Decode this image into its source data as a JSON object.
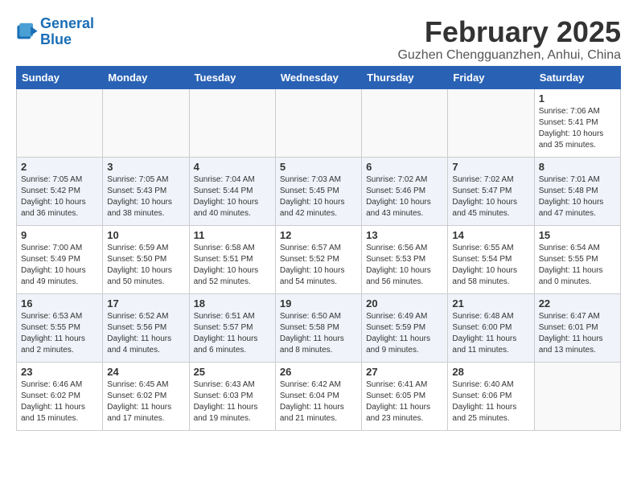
{
  "logo": {
    "general": "General",
    "blue": "Blue"
  },
  "title": "February 2025",
  "subtitle": "Guzhen Chengguanzhen, Anhui, China",
  "days_of_week": [
    "Sunday",
    "Monday",
    "Tuesday",
    "Wednesday",
    "Thursday",
    "Friday",
    "Saturday"
  ],
  "weeks": [
    [
      {
        "day": "",
        "info": ""
      },
      {
        "day": "",
        "info": ""
      },
      {
        "day": "",
        "info": ""
      },
      {
        "day": "",
        "info": ""
      },
      {
        "day": "",
        "info": ""
      },
      {
        "day": "",
        "info": ""
      },
      {
        "day": "1",
        "info": "Sunrise: 7:06 AM\nSunset: 5:41 PM\nDaylight: 10 hours\nand 35 minutes."
      }
    ],
    [
      {
        "day": "2",
        "info": "Sunrise: 7:05 AM\nSunset: 5:42 PM\nDaylight: 10 hours\nand 36 minutes."
      },
      {
        "day": "3",
        "info": "Sunrise: 7:05 AM\nSunset: 5:43 PM\nDaylight: 10 hours\nand 38 minutes."
      },
      {
        "day": "4",
        "info": "Sunrise: 7:04 AM\nSunset: 5:44 PM\nDaylight: 10 hours\nand 40 minutes."
      },
      {
        "day": "5",
        "info": "Sunrise: 7:03 AM\nSunset: 5:45 PM\nDaylight: 10 hours\nand 42 minutes."
      },
      {
        "day": "6",
        "info": "Sunrise: 7:02 AM\nSunset: 5:46 PM\nDaylight: 10 hours\nand 43 minutes."
      },
      {
        "day": "7",
        "info": "Sunrise: 7:02 AM\nSunset: 5:47 PM\nDaylight: 10 hours\nand 45 minutes."
      },
      {
        "day": "8",
        "info": "Sunrise: 7:01 AM\nSunset: 5:48 PM\nDaylight: 10 hours\nand 47 minutes."
      }
    ],
    [
      {
        "day": "9",
        "info": "Sunrise: 7:00 AM\nSunset: 5:49 PM\nDaylight: 10 hours\nand 49 minutes."
      },
      {
        "day": "10",
        "info": "Sunrise: 6:59 AM\nSunset: 5:50 PM\nDaylight: 10 hours\nand 50 minutes."
      },
      {
        "day": "11",
        "info": "Sunrise: 6:58 AM\nSunset: 5:51 PM\nDaylight: 10 hours\nand 52 minutes."
      },
      {
        "day": "12",
        "info": "Sunrise: 6:57 AM\nSunset: 5:52 PM\nDaylight: 10 hours\nand 54 minutes."
      },
      {
        "day": "13",
        "info": "Sunrise: 6:56 AM\nSunset: 5:53 PM\nDaylight: 10 hours\nand 56 minutes."
      },
      {
        "day": "14",
        "info": "Sunrise: 6:55 AM\nSunset: 5:54 PM\nDaylight: 10 hours\nand 58 minutes."
      },
      {
        "day": "15",
        "info": "Sunrise: 6:54 AM\nSunset: 5:55 PM\nDaylight: 11 hours\nand 0 minutes."
      }
    ],
    [
      {
        "day": "16",
        "info": "Sunrise: 6:53 AM\nSunset: 5:55 PM\nDaylight: 11 hours\nand 2 minutes."
      },
      {
        "day": "17",
        "info": "Sunrise: 6:52 AM\nSunset: 5:56 PM\nDaylight: 11 hours\nand 4 minutes."
      },
      {
        "day": "18",
        "info": "Sunrise: 6:51 AM\nSunset: 5:57 PM\nDaylight: 11 hours\nand 6 minutes."
      },
      {
        "day": "19",
        "info": "Sunrise: 6:50 AM\nSunset: 5:58 PM\nDaylight: 11 hours\nand 8 minutes."
      },
      {
        "day": "20",
        "info": "Sunrise: 6:49 AM\nSunset: 5:59 PM\nDaylight: 11 hours\nand 9 minutes."
      },
      {
        "day": "21",
        "info": "Sunrise: 6:48 AM\nSunset: 6:00 PM\nDaylight: 11 hours\nand 11 minutes."
      },
      {
        "day": "22",
        "info": "Sunrise: 6:47 AM\nSunset: 6:01 PM\nDaylight: 11 hours\nand 13 minutes."
      }
    ],
    [
      {
        "day": "23",
        "info": "Sunrise: 6:46 AM\nSunset: 6:02 PM\nDaylight: 11 hours\nand 15 minutes."
      },
      {
        "day": "24",
        "info": "Sunrise: 6:45 AM\nSunset: 6:02 PM\nDaylight: 11 hours\nand 17 minutes."
      },
      {
        "day": "25",
        "info": "Sunrise: 6:43 AM\nSunset: 6:03 PM\nDaylight: 11 hours\nand 19 minutes."
      },
      {
        "day": "26",
        "info": "Sunrise: 6:42 AM\nSunset: 6:04 PM\nDaylight: 11 hours\nand 21 minutes."
      },
      {
        "day": "27",
        "info": "Sunrise: 6:41 AM\nSunset: 6:05 PM\nDaylight: 11 hours\nand 23 minutes."
      },
      {
        "day": "28",
        "info": "Sunrise: 6:40 AM\nSunset: 6:06 PM\nDaylight: 11 hours\nand 25 minutes."
      },
      {
        "day": "",
        "info": ""
      }
    ]
  ]
}
